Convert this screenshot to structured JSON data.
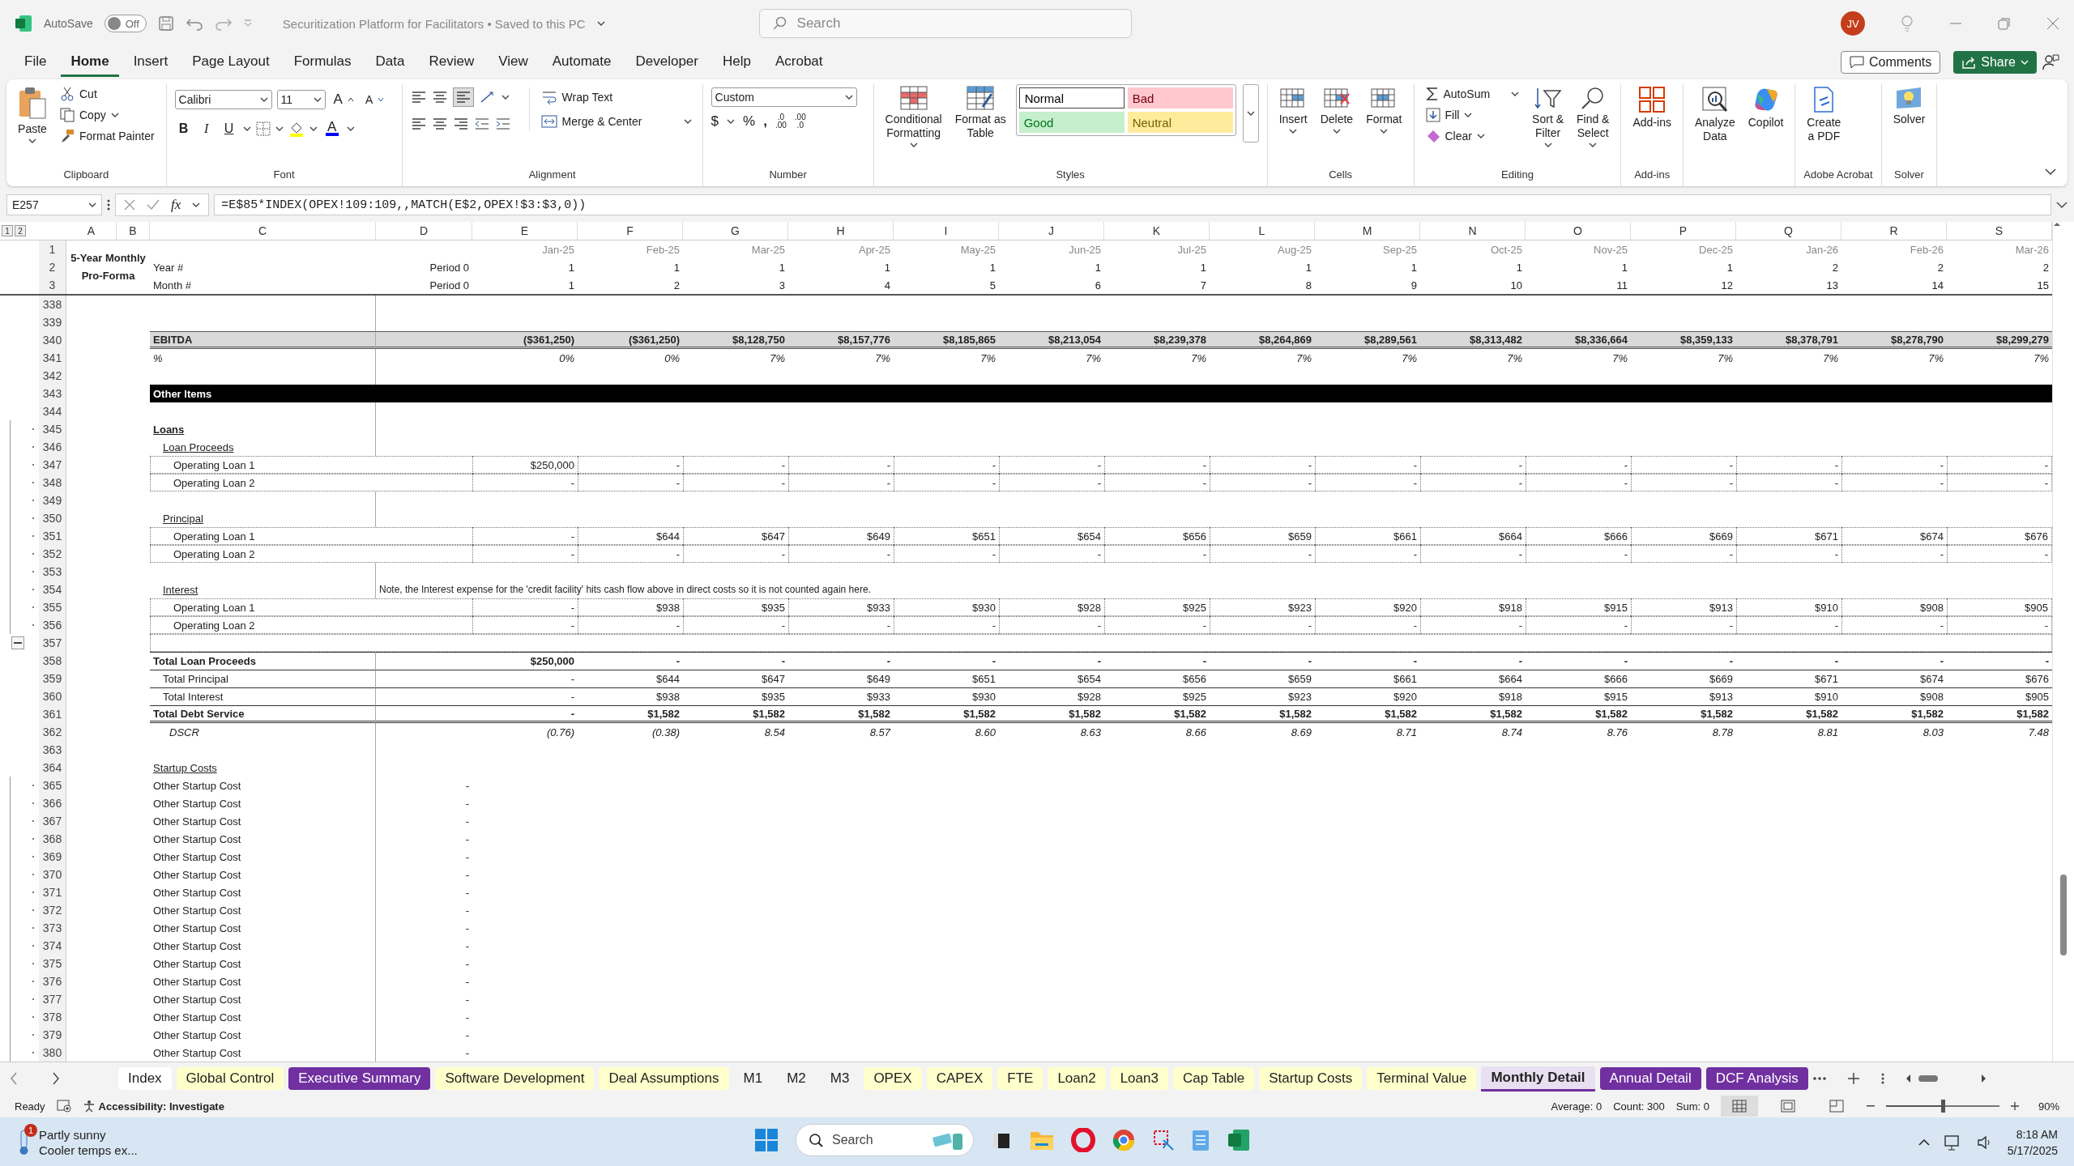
{
  "title_bar": {
    "autosave_label": "AutoSave",
    "autosave_toggle": {
      "label": "Off",
      "on": false
    },
    "document_title": "Securitization Platform for Facilitators • Saved to this PC",
    "search": {
      "placeholder": "Search"
    },
    "avatar": "JV"
  },
  "menu": {
    "tabs": [
      {
        "label": "File",
        "selected": false
      },
      {
        "label": "Home",
        "selected": true
      },
      {
        "label": "Insert",
        "selected": false
      },
      {
        "label": "Page Layout",
        "selected": false
      },
      {
        "label": "Formulas",
        "selected": false
      },
      {
        "label": "Data",
        "selected": false
      },
      {
        "label": "Review",
        "selected": false
      },
      {
        "label": "View",
        "selected": false
      },
      {
        "label": "Automate",
        "selected": false
      },
      {
        "label": "Developer",
        "selected": false
      },
      {
        "label": "Help",
        "selected": false
      },
      {
        "label": "Acrobat",
        "selected": false
      }
    ],
    "comments": "Comments",
    "share": "Share"
  },
  "ribbon": {
    "clipboard": {
      "label": "Clipboard",
      "paste": "Paste",
      "cut": "Cut",
      "copy": "Copy",
      "format_painter": "Format Painter"
    },
    "font": {
      "label": "Font",
      "font_name": "Calibri",
      "font_size": "11",
      "grow_glyph": "A",
      "shrink_glyph": "A",
      "style_buttons": [
        "B",
        "I",
        "U"
      ],
      "color_glyph": "A"
    },
    "alignment": {
      "label": "Alignment",
      "wrap_text": "Wrap Text",
      "merge": "Merge & Center"
    },
    "number": {
      "label": "Number",
      "format": "Custom",
      "symbols": [
        "$",
        "%",
        ","
      ],
      "decimal_buttons": [
        {
          "top": ".0",
          "bottom": ".00"
        },
        {
          "top": ".00",
          "bottom": ".0"
        }
      ]
    },
    "styles": {
      "label": "Styles",
      "conditional": [
        "Conditional",
        "Formatting"
      ],
      "format_table": [
        "Format as",
        "Table"
      ],
      "cell_styles": [
        {
          "label": "Normal",
          "color": "#ffffff"
        },
        {
          "label": "Bad",
          "color": "#ffc7ce"
        },
        {
          "label": "Good",
          "color": "#c6efce"
        },
        {
          "label": "Neutral",
          "color": "#ffeb9c"
        }
      ]
    },
    "cells": {
      "label": "Cells",
      "buttons": [
        "Insert",
        "Delete",
        "Format"
      ]
    },
    "editing": {
      "label": "Editing",
      "autosum": "AutoSum",
      "fill": "Fill",
      "clear": "Clear",
      "sort": [
        "Sort &",
        "Filter"
      ],
      "find": [
        "Find &",
        "Select"
      ]
    },
    "addins": {
      "label": "Add-ins",
      "button": "Add-ins"
    },
    "analysis": {
      "buttons": [
        [
          "Analyze",
          "Data"
        ],
        [
          "Copilot"
        ]
      ]
    },
    "acrobat": {
      "label": "Adobe Acrobat",
      "button": [
        "Create",
        "a PDF"
      ]
    },
    "solver": {
      "label": "Solver",
      "button": "Solver"
    }
  },
  "formula_bar": {
    "name_box": "E257",
    "fx": "fx",
    "formula": "=E$85*INDEX(OPEX!109:109,,MATCH(E$2,OPEX!$3:$3,0))"
  },
  "outline_levels": [
    "1",
    "2"
  ],
  "columns": [
    "A",
    "B",
    "C",
    "D",
    "E",
    "F",
    "G",
    "H",
    "I",
    "J",
    "K",
    "L",
    "M",
    "N",
    "O",
    "P",
    "Q",
    "R",
    "S"
  ],
  "frozen": {
    "title": "5-Year Monthly Pro-Forma",
    "rows": [
      {
        "n": "1",
        "values": [
          "Jan-25",
          "Feb-25",
          "Mar-25",
          "Apr-25",
          "May-25",
          "Jun-25",
          "Jul-25",
          "Aug-25",
          "Sep-25",
          "Oct-25",
          "Nov-25",
          "Dec-25",
          "Jan-26",
          "Feb-26",
          "Mar-26"
        ]
      },
      {
        "n": "2",
        "label": "Year #",
        "d": "Period 0",
        "values": [
          "1",
          "1",
          "1",
          "1",
          "1",
          "1",
          "1",
          "1",
          "1",
          "1",
          "1",
          "1",
          "2",
          "2",
          "2"
        ]
      },
      {
        "n": "3",
        "label": "Month #",
        "d": "Period 0",
        "values": [
          "1",
          "2",
          "3",
          "4",
          "5",
          "6",
          "7",
          "8",
          "9",
          "10",
          "11",
          "12",
          "13",
          "14",
          "15"
        ]
      }
    ]
  },
  "rows": [
    {
      "n": "338",
      "kind": "blank",
      "grouped": false,
      "collapse": false
    },
    {
      "n": "339",
      "kind": "blank",
      "grouped": false,
      "collapse": false
    },
    {
      "n": "340",
      "kind": "ebitda",
      "label": "EBITDA",
      "grouped": false,
      "collapse": false,
      "values": [
        "($361,250)",
        "($361,250)",
        "$8,128,750",
        "$8,157,776",
        "$8,185,865",
        "$8,213,054",
        "$8,239,378",
        "$8,264,869",
        "$8,289,561",
        "$8,313,482",
        "$8,336,664",
        "$8,359,133",
        "$8,378,791",
        "$8,278,790",
        "$8,299,279"
      ]
    },
    {
      "n": "341",
      "kind": "percent",
      "label": "%",
      "grouped": false,
      "collapse": false,
      "values": [
        "0%",
        "0%",
        "7%",
        "7%",
        "7%",
        "7%",
        "7%",
        "7%",
        "7%",
        "7%",
        "7%",
        "7%",
        "7%",
        "7%",
        "7%"
      ]
    },
    {
      "n": "342",
      "kind": "blank",
      "grouped": false,
      "collapse": false
    },
    {
      "n": "343",
      "kind": "section",
      "label": "Other Items",
      "grouped": false,
      "collapse": false
    },
    {
      "n": "344",
      "kind": "blank",
      "grouped": false,
      "collapse": false
    },
    {
      "n": "345",
      "kind": "group",
      "label": "Loans",
      "grouped": true,
      "collapse": false
    },
    {
      "n": "346",
      "kind": "subgroup",
      "label": "Loan Proceeds",
      "grouped": true,
      "collapse": false
    },
    {
      "n": "347",
      "kind": "item",
      "label": "Operating Loan 1",
      "grouped": true,
      "collapse": false,
      "values": [
        "$250,000",
        "-",
        "-",
        "-",
        "-",
        "-",
        "-",
        "-",
        "-",
        "-",
        "-",
        "-",
        "-",
        "-",
        "-"
      ]
    },
    {
      "n": "348",
      "kind": "item",
      "label": "Operating Loan 2",
      "grouped": true,
      "collapse": false,
      "values": [
        "-",
        "-",
        "-",
        "-",
        "-",
        "-",
        "-",
        "-",
        "-",
        "-",
        "-",
        "-",
        "-",
        "-",
        "-"
      ]
    },
    {
      "n": "349",
      "kind": "blank",
      "grouped": true,
      "collapse": false
    },
    {
      "n": "350",
      "kind": "subgroup",
      "label": "Principal",
      "grouped": true,
      "collapse": false
    },
    {
      "n": "351",
      "kind": "item",
      "label": "Operating Loan 1",
      "grouped": true,
      "collapse": false,
      "values": [
        "-",
        "$644",
        "$647",
        "$649",
        "$651",
        "$654",
        "$656",
        "$659",
        "$661",
        "$664",
        "$666",
        "$669",
        "$671",
        "$674",
        "$676"
      ]
    },
    {
      "n": "352",
      "kind": "item",
      "label": "Operating Loan 2",
      "grouped": true,
      "collapse": false,
      "values": [
        "-",
        "-",
        "-",
        "-",
        "-",
        "-",
        "-",
        "-",
        "-",
        "-",
        "-",
        "-",
        "-",
        "-",
        "-"
      ]
    },
    {
      "n": "353",
      "kind": "blank",
      "grouped": true,
      "collapse": false
    },
    {
      "n": "354",
      "kind": "subgroup",
      "label": "Interest",
      "grouped": true,
      "collapse": false,
      "note": "Note, the Interest expense for the 'credit facility' hits cash flow above in direct costs so it is not counted again here."
    },
    {
      "n": "355",
      "kind": "item",
      "label": "Operating Loan 1",
      "grouped": true,
      "collapse": false,
      "values": [
        "-",
        "$938",
        "$935",
        "$933",
        "$930",
        "$928",
        "$925",
        "$923",
        "$920",
        "$918",
        "$915",
        "$913",
        "$910",
        "$908",
        "$905"
      ]
    },
    {
      "n": "356",
      "kind": "item",
      "label": "Operating Loan 2",
      "grouped": true,
      "collapse": false,
      "values": [
        "-",
        "-",
        "-",
        "-",
        "-",
        "-",
        "-",
        "-",
        "-",
        "-",
        "-",
        "-",
        "-",
        "-",
        "-"
      ]
    },
    {
      "n": "357",
      "kind": "blank_box",
      "grouped": false,
      "collapse": true
    },
    {
      "n": "358",
      "kind": "total_bold",
      "label": "Total Loan Proceeds",
      "grouped": false,
      "collapse": false,
      "values": [
        "$250,000",
        "-",
        "-",
        "-",
        "-",
        "-",
        "-",
        "-",
        "-",
        "-",
        "-",
        "-",
        "-",
        "-",
        "-"
      ]
    },
    {
      "n": "359",
      "kind": "total",
      "label": "Total Principal",
      "grouped": false,
      "collapse": false,
      "values": [
        "-",
        "$644",
        "$647",
        "$649",
        "$651",
        "$654",
        "$656",
        "$659",
        "$661",
        "$664",
        "$666",
        "$669",
        "$671",
        "$674",
        "$676"
      ]
    },
    {
      "n": "360",
      "kind": "total",
      "label": "Total Interest",
      "grouped": false,
      "collapse": false,
      "values": [
        "-",
        "$938",
        "$935",
        "$933",
        "$930",
        "$928",
        "$925",
        "$923",
        "$920",
        "$918",
        "$915",
        "$913",
        "$910",
        "$908",
        "$905"
      ]
    },
    {
      "n": "361",
      "kind": "total_double",
      "label": "Total Debt Service",
      "grouped": false,
      "collapse": false,
      "values": [
        "-",
        "$1,582",
        "$1,582",
        "$1,582",
        "$1,582",
        "$1,582",
        "$1,582",
        "$1,582",
        "$1,582",
        "$1,582",
        "$1,582",
        "$1,582",
        "$1,582",
        "$1,582",
        "$1,582"
      ]
    },
    {
      "n": "362",
      "kind": "ratio",
      "label": "DSCR",
      "grouped": false,
      "collapse": false,
      "values": [
        "(0.76)",
        "(0.38)",
        "8.54",
        "8.57",
        "8.60",
        "8.63",
        "8.66",
        "8.69",
        "8.71",
        "8.74",
        "8.76",
        "8.78",
        "8.81",
        "8.03",
        "7.48"
      ]
    },
    {
      "n": "363",
      "kind": "blank",
      "grouped": false,
      "collapse": false
    },
    {
      "n": "364",
      "kind": "group_plain",
      "label": "Startup Costs",
      "grouped": false,
      "collapse": false
    },
    {
      "n": "365",
      "kind": "startup",
      "label": "Other Startup Cost",
      "d": "-",
      "grouped": true,
      "collapse": false
    },
    {
      "n": "366",
      "kind": "startup",
      "label": "Other Startup Cost",
      "d": "-",
      "grouped": true,
      "collapse": false
    },
    {
      "n": "367",
      "kind": "startup",
      "label": "Other Startup Cost",
      "d": "-",
      "grouped": true,
      "collapse": false
    },
    {
      "n": "368",
      "kind": "startup",
      "label": "Other Startup Cost",
      "d": "-",
      "grouped": true,
      "collapse": false
    },
    {
      "n": "369",
      "kind": "startup",
      "label": "Other Startup Cost",
      "d": "-",
      "grouped": true,
      "collapse": false
    },
    {
      "n": "370",
      "kind": "startup",
      "label": "Other Startup Cost",
      "d": "-",
      "grouped": true,
      "collapse": false
    },
    {
      "n": "371",
      "kind": "startup",
      "label": "Other Startup Cost",
      "d": "-",
      "grouped": true,
      "collapse": false
    },
    {
      "n": "372",
      "kind": "startup",
      "label": "Other Startup Cost",
      "d": "-",
      "grouped": true,
      "collapse": false
    },
    {
      "n": "373",
      "kind": "startup",
      "label": "Other Startup Cost",
      "d": "-",
      "grouped": true,
      "collapse": false
    },
    {
      "n": "374",
      "kind": "startup",
      "label": "Other Startup Cost",
      "d": "-",
      "grouped": true,
      "collapse": false
    },
    {
      "n": "375",
      "kind": "startup",
      "label": "Other Startup Cost",
      "d": "-",
      "grouped": true,
      "collapse": false
    },
    {
      "n": "376",
      "kind": "startup",
      "label": "Other Startup Cost",
      "d": "-",
      "grouped": true,
      "collapse": false
    },
    {
      "n": "377",
      "kind": "startup",
      "label": "Other Startup Cost",
      "d": "-",
      "grouped": true,
      "collapse": false
    },
    {
      "n": "378",
      "kind": "startup",
      "label": "Other Startup Cost",
      "d": "-",
      "grouped": true,
      "collapse": false
    },
    {
      "n": "379",
      "kind": "startup",
      "label": "Other Startup Cost",
      "d": "-",
      "grouped": true,
      "collapse": false
    },
    {
      "n": "380",
      "kind": "startup",
      "label": "Other Startup Cost",
      "d": "-",
      "grouped": true,
      "collapse": false
    }
  ],
  "sheet_tabs": [
    {
      "label": "Index",
      "selected": false
    },
    {
      "label": "Global Control",
      "selected": false,
      "color": "#ffffcc"
    },
    {
      "label": "Executive Summary",
      "selected": false,
      "color": "#7030a0"
    },
    {
      "label": "Software Development",
      "selected": false,
      "color": "#ffffcc"
    },
    {
      "label": "Deal Assumptions",
      "selected": false,
      "color": "#ffffcc"
    },
    {
      "label": "M1",
      "selected": false
    },
    {
      "label": "M2",
      "selected": false
    },
    {
      "label": "M3",
      "selected": false
    },
    {
      "label": "OPEX",
      "selected": false,
      "color": "#ffffcc"
    },
    {
      "label": "CAPEX",
      "selected": false,
      "color": "#ffffcc"
    },
    {
      "label": "FTE",
      "selected": false,
      "color": "#ffffcc"
    },
    {
      "label": "Loan2",
      "selected": false,
      "color": "#ffffcc"
    },
    {
      "label": "Loan3",
      "selected": false,
      "color": "#ffffcc"
    },
    {
      "label": "Cap Table",
      "selected": false,
      "color": "#ffffcc"
    },
    {
      "label": "Startup Costs",
      "selected": false,
      "color": "#ffffcc"
    },
    {
      "label": "Terminal Value",
      "selected": false,
      "color": "#ffffcc"
    },
    {
      "label": "Monthly Detail",
      "selected": true,
      "color": "#7030a0"
    },
    {
      "label": "Annual Detail",
      "selected": false,
      "color": "#7030a0"
    },
    {
      "label": "DCF Analysis",
      "selected": false,
      "color": "#7030a0"
    }
  ],
  "status_bar": {
    "ready": "Ready",
    "accessibility": "Accessibility: Investigate",
    "average": "Average: 0",
    "count": "Count: 300",
    "sum": "Sum: 0",
    "views": [
      {
        "kind": "normal",
        "selected": true
      },
      {
        "kind": "page_layout",
        "selected": false
      },
      {
        "kind": "page_break",
        "selected": false
      }
    ],
    "zoom": {
      "level": 0.5,
      "reading": "90%"
    }
  },
  "taskbar": {
    "weather": {
      "badge": "1",
      "title": "Partly sunny",
      "subtitle": "Cooler temps ex..."
    },
    "search": {
      "placeholder": "Search"
    },
    "time": "8:18 AM",
    "date": "5/17/2025"
  }
}
